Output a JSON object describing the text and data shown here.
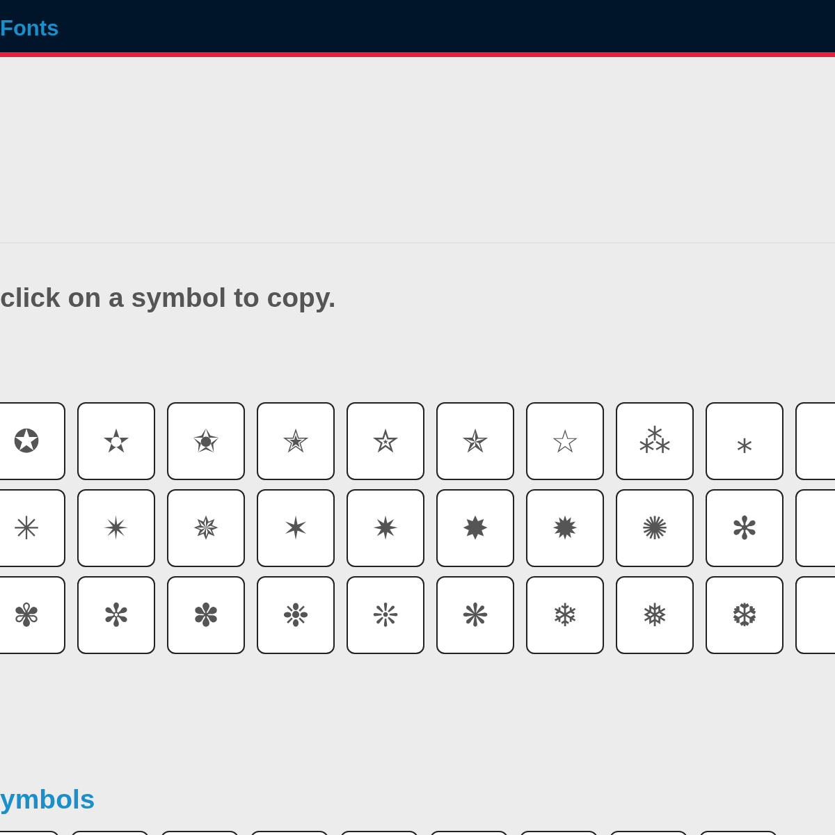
{
  "header": {
    "link": "Fonts"
  },
  "instruction": "click on a symbol to copy.",
  "symbol_grid": {
    "rows": [
      [
        "✪",
        "✫",
        "✬",
        "✭",
        "✮",
        "✯",
        "☆",
        "⁂",
        "⁎"
      ],
      [
        "✳",
        "✴",
        "✵",
        "✶",
        "✷",
        "✸",
        "✹",
        "✺",
        "✻"
      ],
      [
        "✾",
        "✼",
        "✽",
        "❉",
        "❊",
        "❋",
        "❄",
        "❅",
        "❆"
      ]
    ]
  },
  "next_section": {
    "title": "ymbols"
  }
}
